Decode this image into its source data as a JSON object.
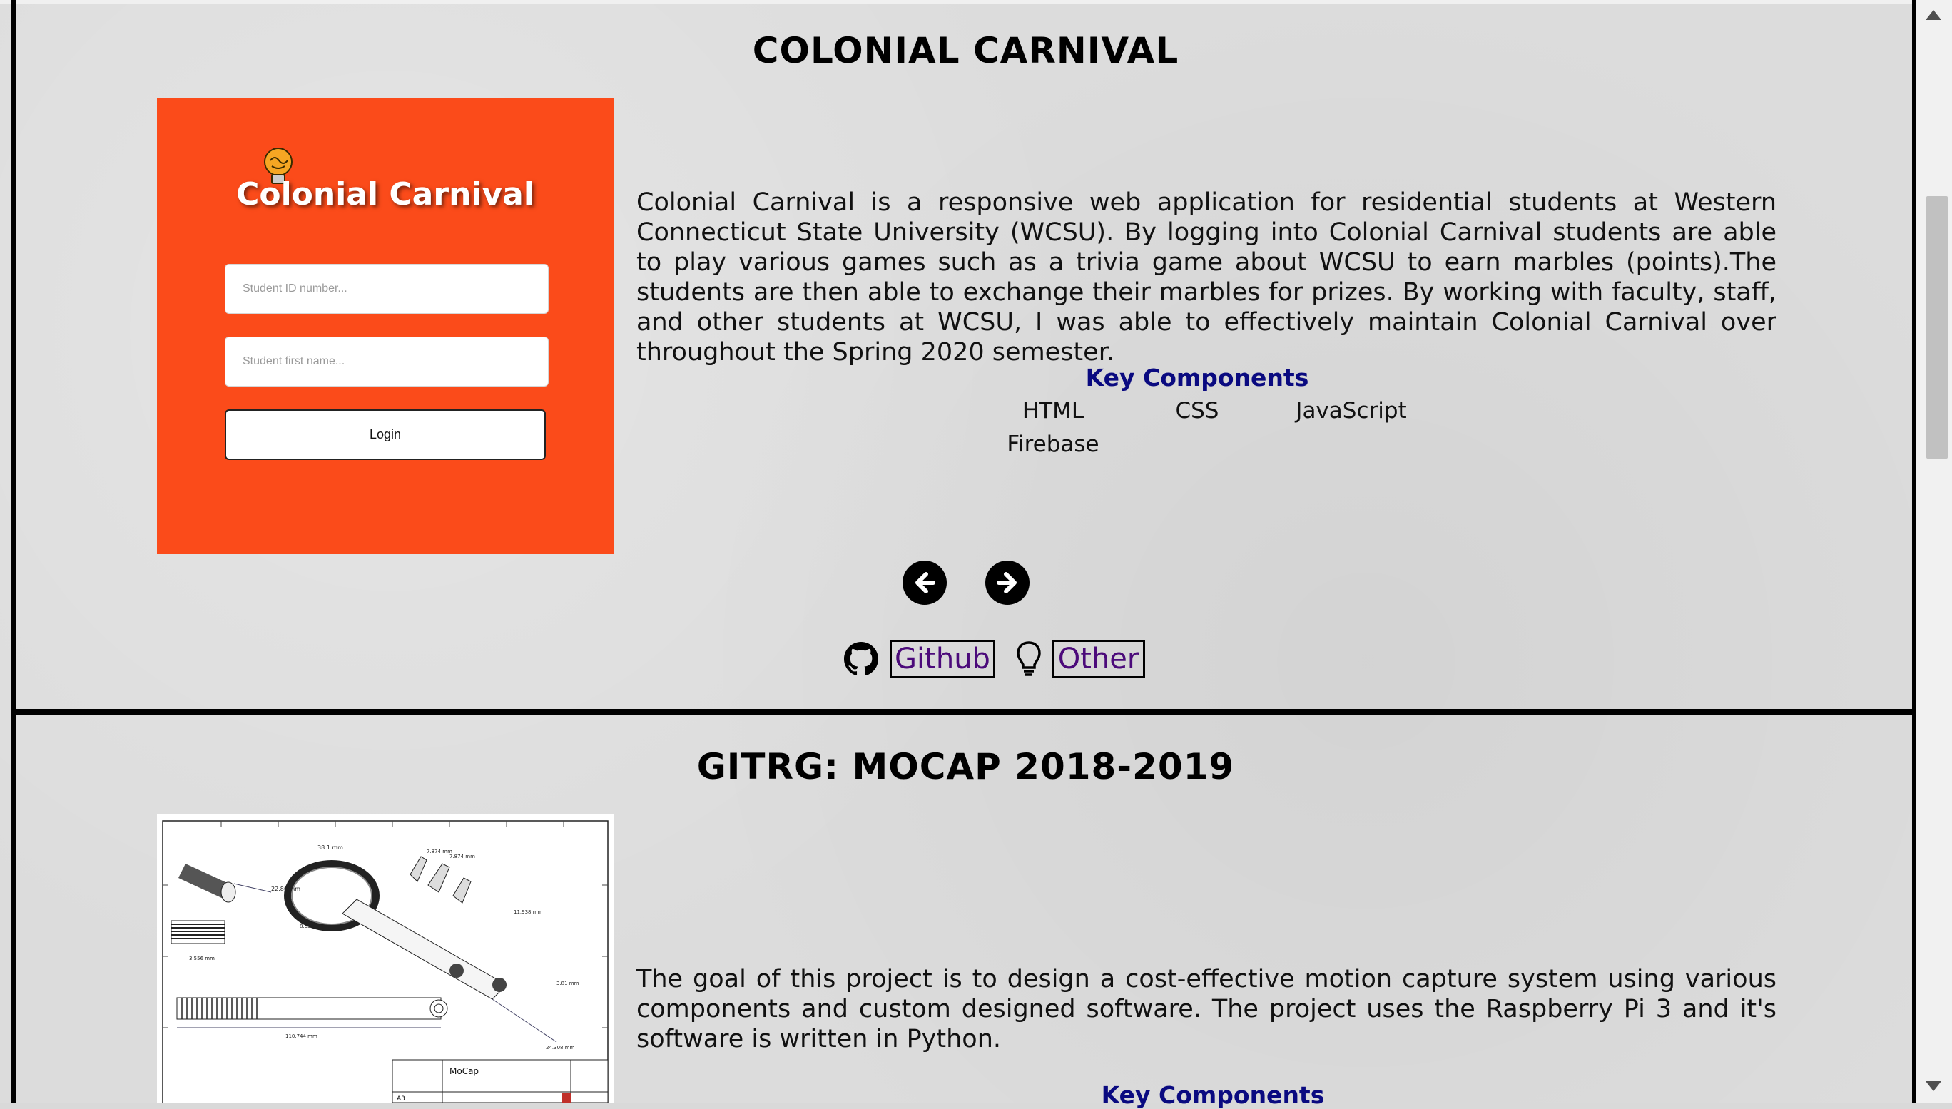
{
  "projects": [
    {
      "title": "COLONIAL CARNIVAL",
      "image": {
        "logo_text": "Colonial Carnival",
        "student_id_placeholder": "Student ID number...",
        "first_name_placeholder": "Student first name...",
        "login_label": "Login"
      },
      "description": "Colonial Carnival is a responsive web application for residential students at Western Connecticut State University (WCSU). By logging into Colonial Carnival students are able to play various games such as a trivia game about WCSU to earn marbles (points).The students are then able to exchange their marbles for prizes. By working with faculty, staff, and other students at WCSU, I was able to effectively maintain Colonial Carnival over throughout the Spring 2020 semester.",
      "key_components_title": "Key Components",
      "key_components": [
        "HTML",
        "CSS",
        "JavaScript",
        "Firebase"
      ],
      "github_label": "Github",
      "other_label": "Other"
    },
    {
      "title": "GITRG: MOCAP 2018-2019",
      "image": {
        "drawing_title": "MoCap",
        "dim_labels": [
          "38.1 mm",
          "22.86 mm",
          "3.556 mm",
          "110.744 mm",
          "7.874 mm",
          "7.874 mm",
          "11.938 mm",
          "8.636 mm",
          "24.308 mm",
          "3.81 mm"
        ],
        "sheet_size": "A3"
      },
      "description": "The goal of this project is to design a cost-effective motion capture system using various components and custom designed software. The project uses the Raspberry Pi 3 and it's software is written in Python.",
      "key_components_title": "Key Components"
    }
  ],
  "icons": {
    "prev": "arrow-left-circle-icon",
    "next": "arrow-right-circle-icon",
    "github": "github-icon",
    "other": "lightbulb-icon"
  }
}
